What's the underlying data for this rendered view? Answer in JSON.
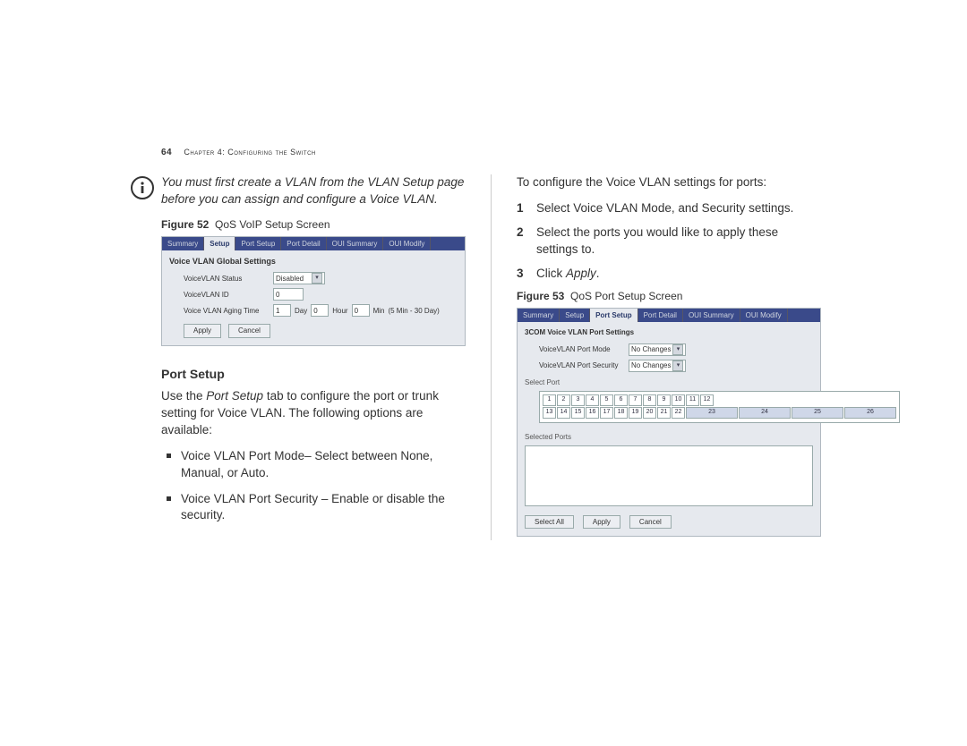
{
  "header": {
    "page_number": "64",
    "chapter": "Chapter 4: Configuring the Switch"
  },
  "left_col": {
    "note": "You must first create a VLAN from the VLAN Setup page before you can assign and configure a Voice VLAN.",
    "fig52_label": "Figure 52",
    "fig52_caption": "QoS VoIP Setup Screen",
    "fig52": {
      "tabs": [
        "Summary",
        "Setup",
        "Port Setup",
        "Port Detail",
        "OUI Summary",
        "OUI Modify"
      ],
      "active_tab": "Setup",
      "panel_title": "Voice VLAN Global Settings",
      "status_label": "VoiceVLAN Status",
      "status_value": "Disabled",
      "id_label": "VoiceVLAN ID",
      "id_value": "0",
      "aging_label": "Voice VLAN Aging Time",
      "aging_day_val": "1",
      "aging_day_unit": "Day",
      "aging_hour_val": "0",
      "aging_hour_unit": "Hour",
      "aging_min_val": "0",
      "aging_min_unit": "Min",
      "aging_range": "(5 Min - 30 Day)",
      "apply_btn": "Apply",
      "cancel_btn": "Cancel"
    },
    "port_setup_heading": "Port Setup",
    "port_setup_para_prefix": "Use the ",
    "port_setup_italic": "Port Setup",
    "port_setup_para_suffix": " tab to configure the port or trunk setting for Voice VLAN. The following options are available:",
    "bullet1": "Voice VLAN Port Mode– Select between None, Manual, or Auto.",
    "bullet2": "Voice VLAN Port Security – Enable or disable the security."
  },
  "right_col": {
    "intro": "To configure the Voice VLAN settings for ports:",
    "step1": "Select Voice VLAN Mode, and Security settings.",
    "step2": "Select the ports you would like to apply these settings to.",
    "step3_prefix": "Click ",
    "step3_italic": "Apply",
    "step3_suffix": ".",
    "fig53_label": "Figure 53",
    "fig53_caption": "QoS Port Setup Screen",
    "fig53": {
      "tabs": [
        "Summary",
        "Setup",
        "Port Setup",
        "Port Detail",
        "OUI Summary",
        "OUI Modify"
      ],
      "active_tab": "Port Setup",
      "panel_title": "3COM Voice VLAN Port Settings",
      "mode_label": "VoiceVLAN Port Mode",
      "mode_value": "No Changes",
      "sec_label": "VoiceVLAN Port Security",
      "sec_value": "No Changes",
      "select_port_label": "Select Port",
      "ports_top": [
        "1",
        "2",
        "3",
        "4",
        "5",
        "6",
        "7",
        "8",
        "9",
        "10",
        "11",
        "12"
      ],
      "ports_bottom": [
        "13",
        "14",
        "15",
        "16",
        "17",
        "18",
        "19",
        "20",
        "21",
        "22",
        "23",
        "24",
        "25",
        "26"
      ],
      "selected_ports_label": "Selected Ports",
      "selectall_btn": "Select All",
      "apply_btn": "Apply",
      "cancel_btn": "Cancel"
    }
  }
}
